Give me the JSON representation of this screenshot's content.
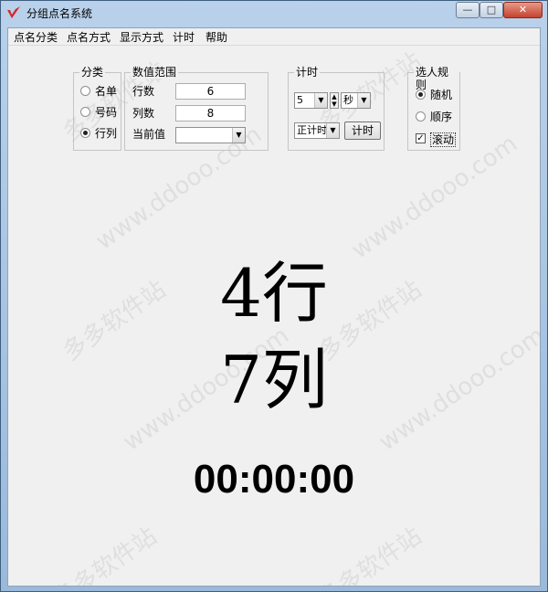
{
  "window": {
    "title": "分组点名系统",
    "minimize": "—",
    "maximize": "□",
    "close": "✕"
  },
  "menu": [
    "点名分类",
    "点名方式",
    "显示方式",
    "计时",
    "帮助"
  ],
  "category": {
    "legend": "分类",
    "options": [
      "名单",
      "号码",
      "行列"
    ],
    "selected": 2
  },
  "range": {
    "legend": "数值范围",
    "rows_label": "行数",
    "rows_value": "6",
    "cols_label": "列数",
    "cols_value": "8",
    "current_label": "当前值",
    "current_value": ""
  },
  "timer": {
    "legend": "计时",
    "amount": "5",
    "unit": "秒",
    "mode": "正计时",
    "button": "计时"
  },
  "rules": {
    "legend": "选人规则",
    "options": [
      "随机",
      "顺序"
    ],
    "selected": 0,
    "scroll_label": "滚动",
    "scroll_checked": true
  },
  "display": {
    "line1": "4行",
    "line2": "7列",
    "clock": "00:00:00"
  },
  "watermark": {
    "text1": "多多软件站",
    "text2": "www.ddooo.com"
  }
}
